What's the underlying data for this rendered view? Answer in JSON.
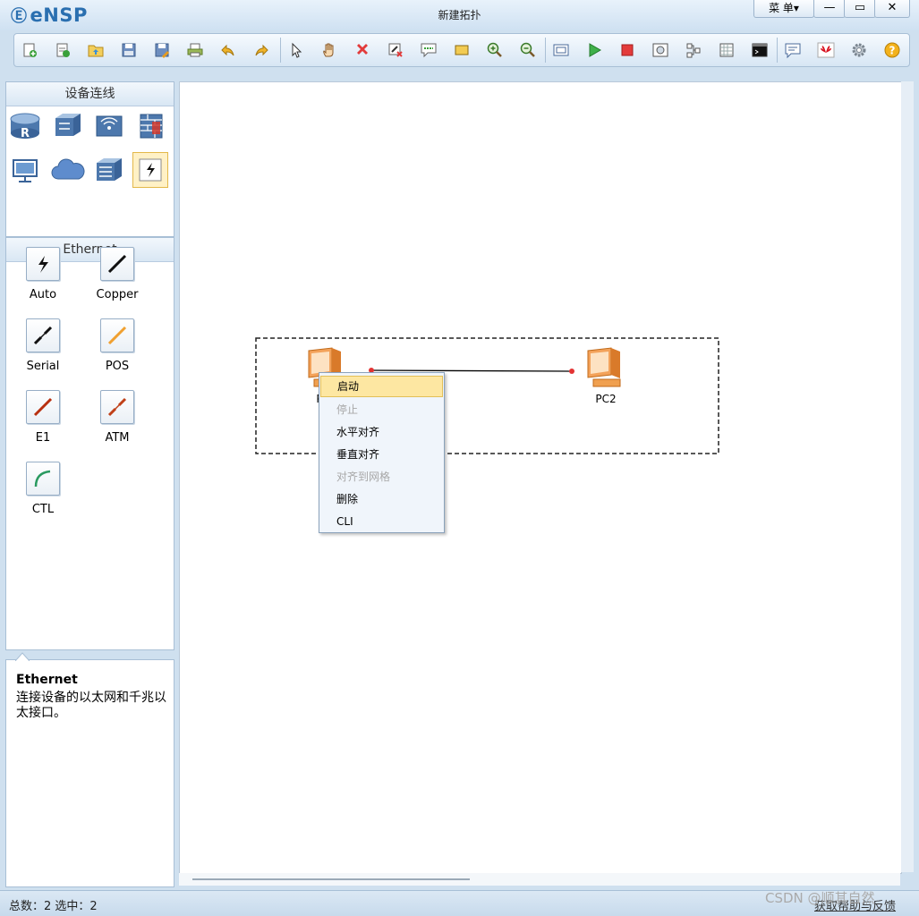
{
  "app": {
    "logo": "eNSP",
    "window_title": "新建拓扑"
  },
  "titlebar": {
    "menu_label": "菜 单▾",
    "minimize": "—",
    "maximize": "▭",
    "close": "✕"
  },
  "toolbar": {
    "icons": [
      "new-topology-icon",
      "new-topology-alt-icon",
      "open-icon",
      "save-icon",
      "save-as-icon",
      "print-icon",
      "undo-icon",
      "redo-icon",
      "select-pointer-icon",
      "hand-pan-icon",
      "delete-icon",
      "delete-connection-icon",
      "text-note-icon",
      "rectangle-icon",
      "zoom-in-icon",
      "zoom-out-icon",
      "fit-view-icon",
      "start-device-icon",
      "stop-device-icon",
      "capture-icon",
      "topology-icon",
      "grid-icon",
      "cli-window-icon",
      "chat-icon",
      "huawei-icon",
      "settings-icon",
      "help-icon"
    ]
  },
  "device_panel": {
    "title": "设备连线",
    "devices": [
      "router-icon",
      "switch-icon",
      "wlan-icon",
      "firewall-icon",
      "pc-icon",
      "cloud-icon",
      "other-device-icon",
      "connection-icon"
    ]
  },
  "cable_panel": {
    "title": "Ethernet",
    "cables": [
      {
        "label": "Auto",
        "color": "#000000"
      },
      {
        "label": "Copper",
        "color": "#000000"
      },
      {
        "label": "Serial",
        "color": "#000000"
      },
      {
        "label": "POS",
        "color": "#f0a030"
      },
      {
        "label": "E1",
        "color": "#b83010"
      },
      {
        "label": "ATM",
        "color": "#c04018"
      },
      {
        "label": "CTL",
        "color": "#2a9a60"
      }
    ]
  },
  "description": {
    "title": "Ethernet",
    "text": "连接设备的以太网和千兆以太接口。"
  },
  "canvas": {
    "devices": [
      {
        "label": "PC1"
      },
      {
        "label": "PC2"
      }
    ],
    "link_color": "#000000",
    "port_color": "#e33333"
  },
  "context_menu": {
    "items": [
      {
        "label": "启动",
        "state": "highlighted"
      },
      {
        "label": "停止",
        "state": "disabled"
      },
      {
        "label": "水平对齐",
        "state": "normal"
      },
      {
        "label": "垂直对齐",
        "state": "normal"
      },
      {
        "label": "对齐到网格",
        "state": "disabled"
      },
      {
        "label": "删除",
        "state": "normal"
      },
      {
        "label": "CLI",
        "state": "normal"
      }
    ]
  },
  "statusbar": {
    "text": "总数：2  选中：2",
    "right_link": "获取帮助与反馈"
  },
  "watermark": "CSDN @顺其自然"
}
